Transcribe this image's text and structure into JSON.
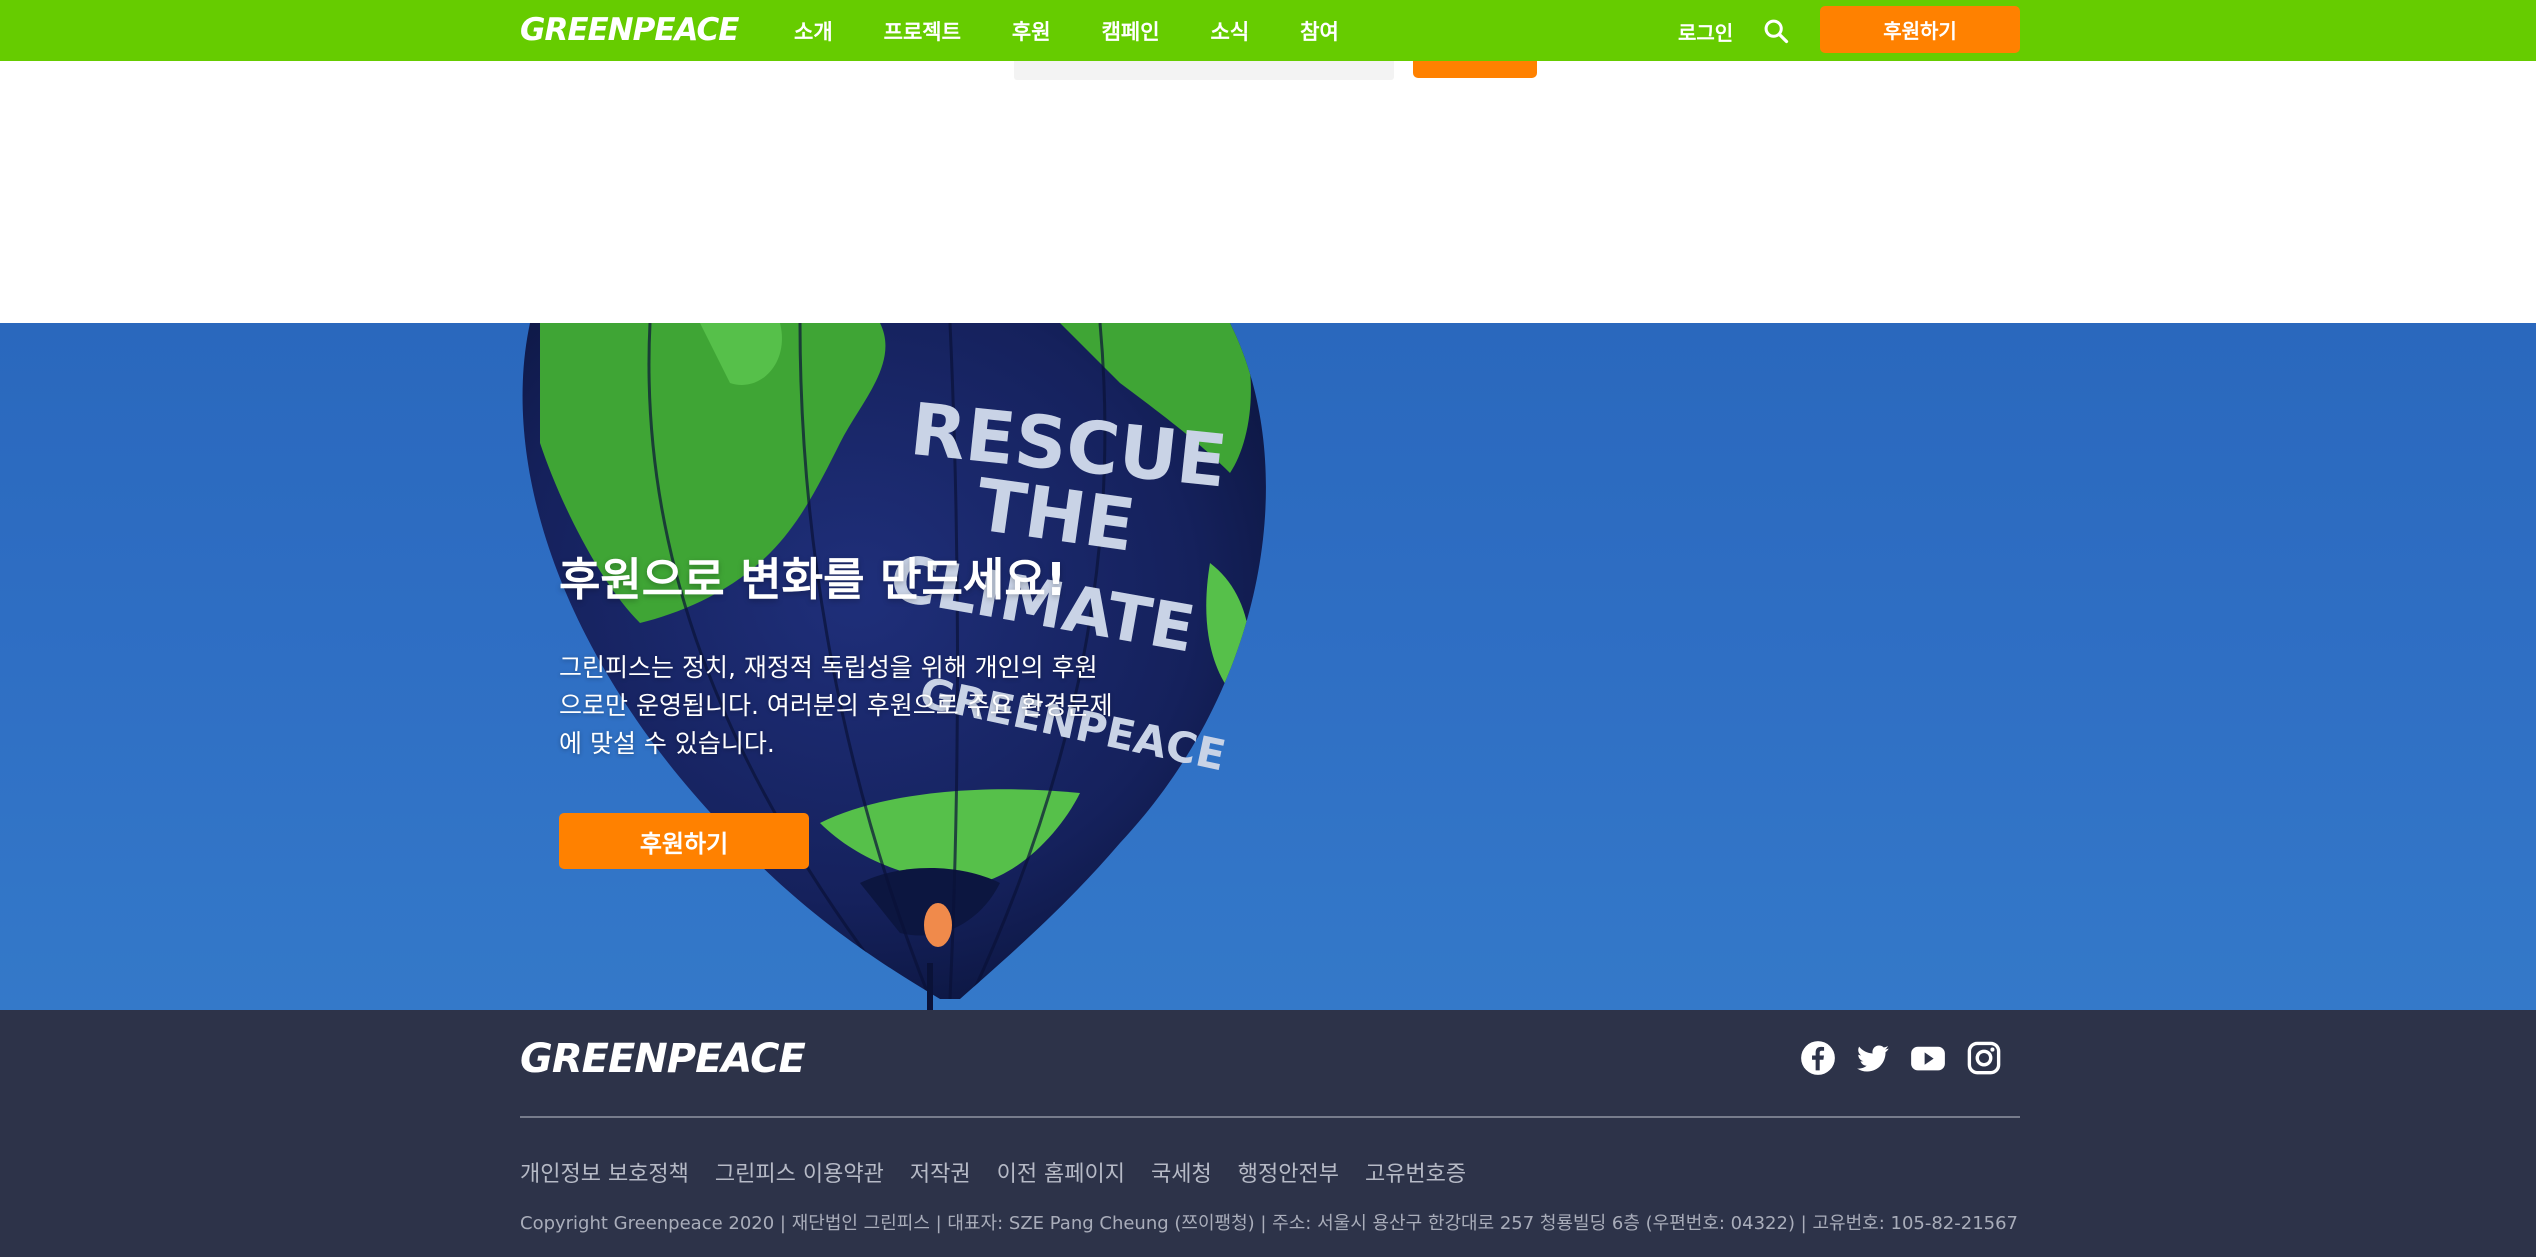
{
  "header": {
    "logo": "GREENPEACE",
    "nav": [
      "소개",
      "프로젝트",
      "후원",
      "캠페인",
      "소식",
      "참여"
    ],
    "login": "로그인",
    "search_icon": "search-icon",
    "donate": "후원하기"
  },
  "hero": {
    "title": "후원으로 변화를 만드세요!",
    "text": "그린피스는 정치, 재정적 독립성을 위해 개인의 후원으로만 운영됩니다. 여러분의 후원으로 주요 환경문제에 맞설 수 있습니다.",
    "button": "후원하기",
    "balloon_text": [
      "RESCUE",
      "THE",
      "CLIMATE",
      "GREENPEACE"
    ]
  },
  "footer": {
    "logo": "GREENPEACE",
    "social": [
      "facebook-icon",
      "twitter-icon",
      "youtube-icon",
      "instagram-icon"
    ],
    "links": [
      "개인정보 보호정책",
      "그린피스 이용약관",
      "저작권",
      "이전 홈페이지",
      "국세청",
      "행정안전부",
      "고유번호증"
    ],
    "copyright": "Copyright Greenpeace 2020 | 재단법인 그린피스 | 대표자: SZE Pang Cheung (쯔이팽청) | 주소: 서울시 용산구 한강대로 257 청룡빌딩 6층 (우편번호: 04322) | 고유번호: 105-82-21567"
  },
  "colors": {
    "header_green": "#66cc00",
    "accent_orange": "#ff8100",
    "footer_navy": "#2d3349",
    "sky_blue": "#2f6fc4"
  }
}
